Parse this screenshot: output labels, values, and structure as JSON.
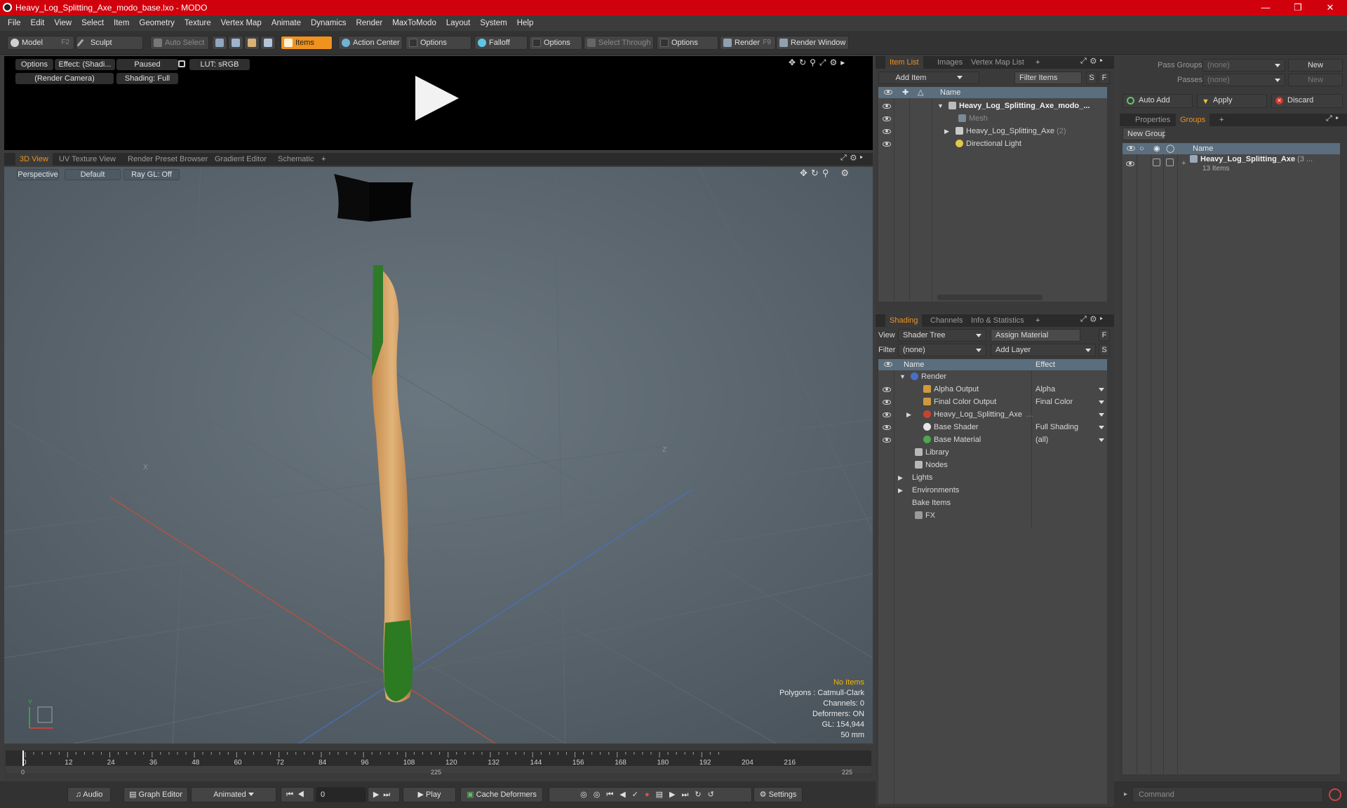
{
  "window": {
    "title": "Heavy_Log_Splitting_Axe_modo_base.lxo - MODO"
  },
  "menu": [
    "File",
    "Edit",
    "View",
    "Select",
    "Item",
    "Geometry",
    "Texture",
    "Vertex Map",
    "Animate",
    "Dynamics",
    "Render",
    "MaxToModo",
    "Layout",
    "System",
    "Help"
  ],
  "toolbar": {
    "model": "Model",
    "model_key": "F2",
    "sculpt": "Sculpt",
    "auto_select": "Auto Select",
    "items": "Items",
    "action_center": "Action Center",
    "options1": "Options",
    "falloff": "Falloff",
    "options2": "Options",
    "select_through": "Select Through",
    "options3": "Options",
    "render": "Render",
    "render_key": "F9",
    "render_window": "Render Window"
  },
  "preview": {
    "options": "Options",
    "effect": "Effect: (Shadi...",
    "paused": "Paused",
    "lut": "LUT: sRGB",
    "camera": "(Render Camera)",
    "shading": "Shading: Full"
  },
  "viewport_tabs": [
    "3D View",
    "UV Texture View",
    "Render Preset Browser",
    "Gradient Editor",
    "Schematic"
  ],
  "viewport": {
    "perspective": "Perspective",
    "default": "Default",
    "raygl": "Ray GL: Off",
    "axis_x": "X",
    "axis_z": "Z",
    "axis_y": "Y"
  },
  "hud": {
    "no_items": "No Items",
    "polygons": "Polygons : Catmull-Clark",
    "channels": "Channels: 0",
    "deformers": "Deformers: ON",
    "gl": "GL: 154,944",
    "mm": "50 mm"
  },
  "timeline": {
    "ticks": [
      "0",
      "12",
      "24",
      "36",
      "48",
      "60",
      "72",
      "84",
      "96",
      "108",
      "120",
      "132",
      "144",
      "156",
      "168",
      "180",
      "192",
      "204",
      "216"
    ],
    "start": "0",
    "mid": "225",
    "end": "225"
  },
  "bottom": {
    "audio": "Audio",
    "graph_editor": "Graph Editor",
    "animated": "Animated",
    "frame": "0",
    "play": "Play",
    "cache": "Cache Deformers",
    "settings": "Settings"
  },
  "item_list": {
    "tabs": [
      "Item List",
      "Images",
      "Vertex Map List"
    ],
    "add_item": "Add Item",
    "filter": "Filter Items",
    "s": "S",
    "f": "F",
    "col_name": "Name",
    "rows": [
      {
        "label": "Heavy_Log_Splitting_Axe_modo_...",
        "suffix": ""
      },
      {
        "label": "Mesh",
        "suffix": ""
      },
      {
        "label": "Heavy_Log_Splitting_Axe",
        "suffix": "(2)"
      },
      {
        "label": "Directional Light",
        "suffix": ""
      }
    ]
  },
  "shading": {
    "tabs": [
      "Shading",
      "Channels",
      "Info & Statistics"
    ],
    "view_label": "View",
    "view_value": "Shader Tree",
    "assign": "Assign Material",
    "filter_label": "Filter",
    "filter_value": "(none)",
    "add_layer": "Add Layer",
    "f": "F",
    "s": "S",
    "col_name": "Name",
    "col_effect": "Effect",
    "rows": [
      {
        "name": "Render",
        "effect": ""
      },
      {
        "name": "Alpha Output",
        "effect": "Alpha"
      },
      {
        "name": "Final Color Output",
        "effect": "Final Color"
      },
      {
        "name": "Heavy_Log_Splitting_Axe",
        "effect": ""
      },
      {
        "name": "Base Shader",
        "effect": "Full Shading"
      },
      {
        "name": "Base Material",
        "effect": "(all)"
      },
      {
        "name": "Library",
        "effect": ""
      },
      {
        "name": "Nodes",
        "effect": ""
      },
      {
        "name": "Lights",
        "effect": ""
      },
      {
        "name": "Environments",
        "effect": ""
      },
      {
        "name": "Bake Items",
        "effect": ""
      },
      {
        "name": "FX",
        "effect": ""
      }
    ]
  },
  "groups": {
    "pass_groups": "Pass Groups",
    "passes": "Passes",
    "none1": "(none)",
    "none2": "(none)",
    "new1": "New",
    "new2": "New",
    "auto_add": "Auto Add",
    "apply": "Apply",
    "discard": "Discard",
    "tabs": [
      "Properties",
      "Groups"
    ],
    "new_group": "New Group",
    "col_name": "Name",
    "group_name": "Heavy_Log_Splitting_Axe",
    "group_suffix": "(3 ...",
    "group_items": "13 Items"
  },
  "command": {
    "placeholder": "Command"
  }
}
